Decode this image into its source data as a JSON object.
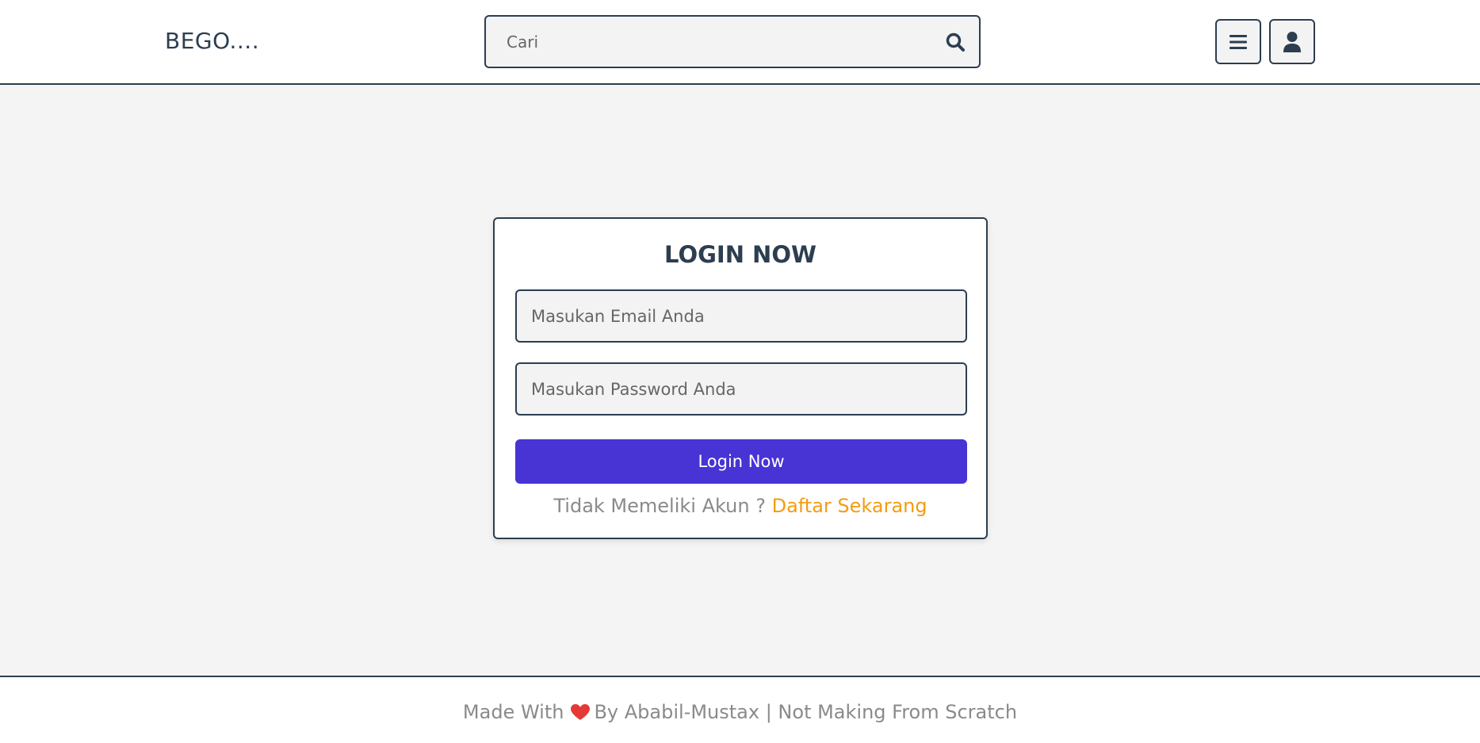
{
  "header": {
    "logo": "BEGO....",
    "search": {
      "placeholder": "Cari",
      "icon": "search-icon"
    },
    "menu_icon": "menu-icon",
    "user_icon": "user-icon"
  },
  "login": {
    "title": "LOGIN NOW",
    "email_placeholder": "Masukan Email Anda",
    "password_placeholder": "Masukan Password Anda",
    "submit_label": "Login Now",
    "register_prompt": "Tidak Memeliki Akun ?",
    "register_link": "Daftar Sekarang"
  },
  "footer": {
    "made_with": "Made With",
    "heart_icon": "heart-icon",
    "credit": "By Ababil-Mustax | Not Making From Scratch"
  },
  "colors": {
    "primary": "#2c3e50",
    "accent_button": "#4833d5",
    "link": "#f39c12",
    "heart": "#e53935",
    "background": "#f4f4f4"
  }
}
